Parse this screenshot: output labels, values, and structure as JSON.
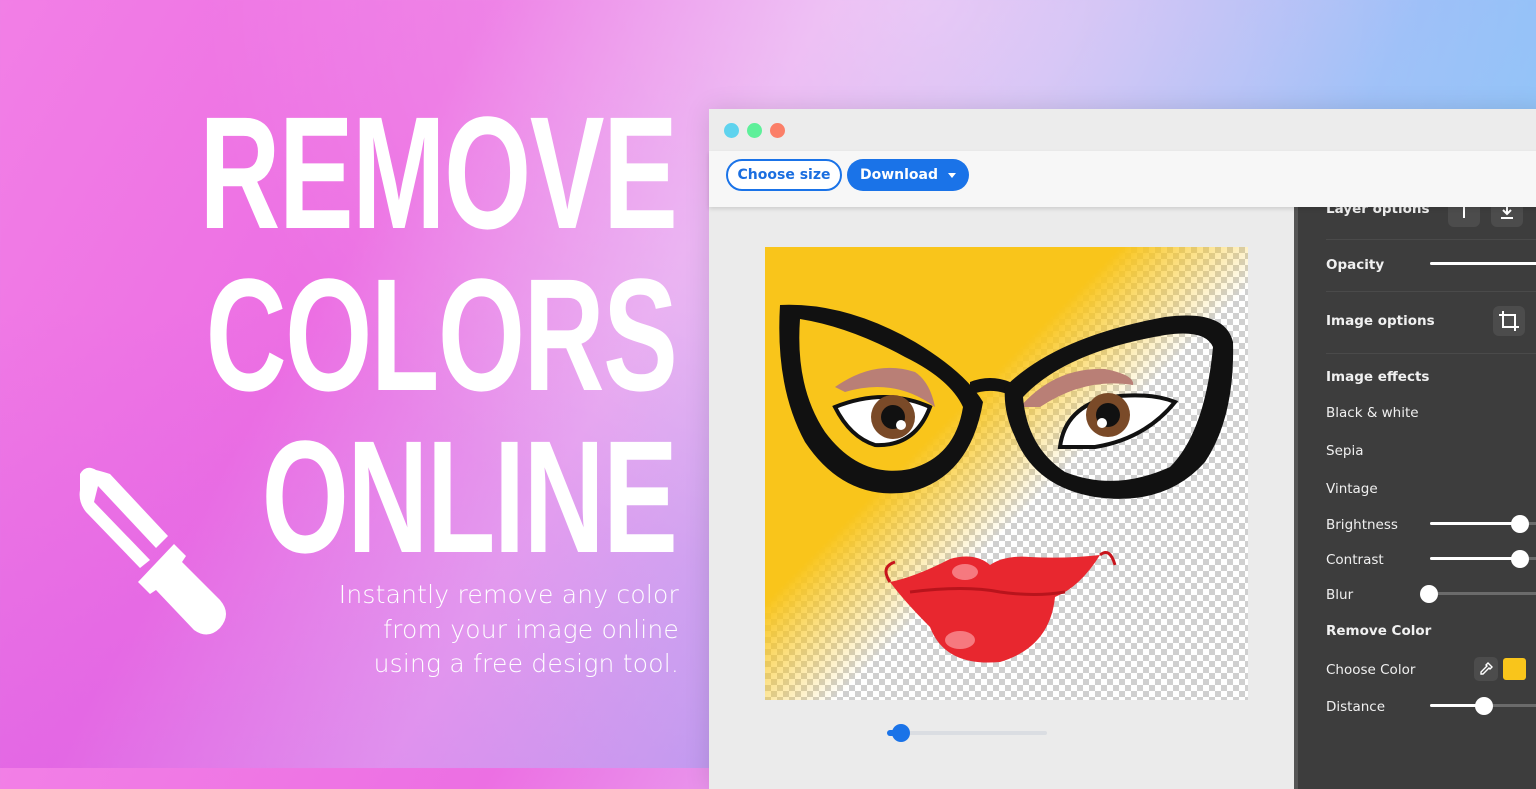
{
  "hero": {
    "headline_lines": [
      "REMOVE",
      "COLORS",
      "ONLINE"
    ],
    "subtext_lines": [
      "Instantly remove any color",
      "from your image online",
      "using a free design tool."
    ],
    "icon": "eyedropper-icon"
  },
  "window": {
    "traffic_lights": [
      {
        "name": "close",
        "color": "#5fd3ee"
      },
      {
        "name": "minimize",
        "color": "#5ef09a"
      },
      {
        "name": "maximize",
        "color": "#fb7f68"
      }
    ],
    "toolbar": {
      "choose_size_label": "Choose size",
      "download_label": "Download"
    },
    "canvas": {
      "zoom_level_fraction": 0.05,
      "removed_color": "#f9c51b"
    },
    "panel": {
      "layer_options_label": "Layer options",
      "opacity_label": "Opacity",
      "opacity_value": 1.0,
      "image_options_label": "Image options",
      "image_effects_label": "Image effects",
      "effects": [
        "Black & white",
        "Sepia",
        "Vintage"
      ],
      "brightness_label": "Brightness",
      "brightness_value": 0.5,
      "contrast_label": "Contrast",
      "contrast_value": 0.5,
      "blur_label": "Blur",
      "blur_value": 0.0,
      "remove_color_label": "Remove Color",
      "choose_color_label": "Choose Color",
      "chosen_color": "#f9c51b",
      "distance_label": "Distance",
      "distance_value": 0.3
    }
  },
  "colors": {
    "accent": "#1a73e8",
    "panel_bg": "#3d3d3d"
  }
}
